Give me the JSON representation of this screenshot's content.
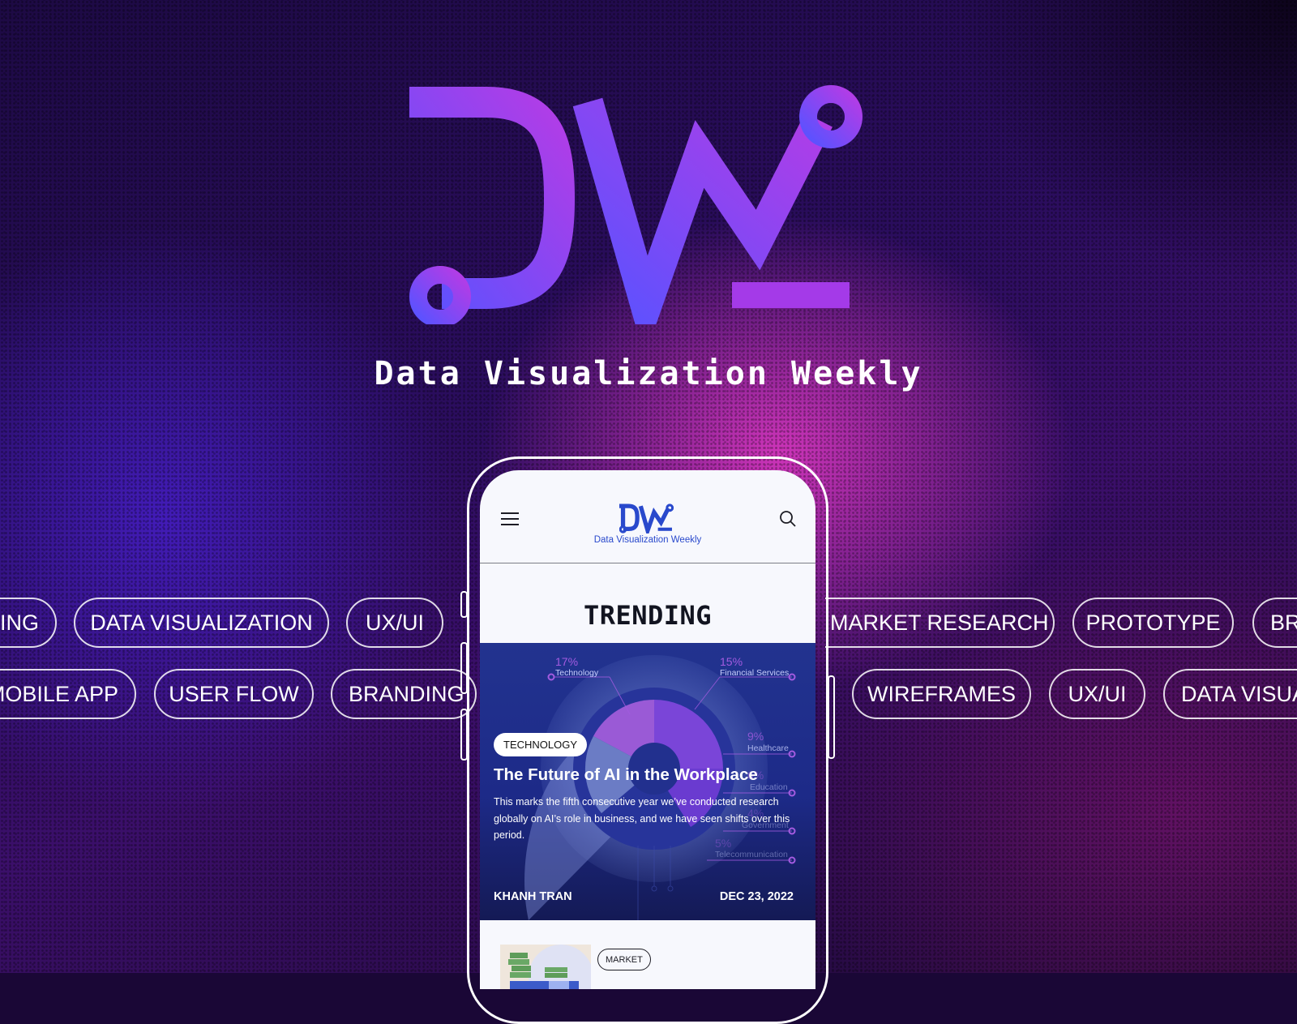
{
  "brand": {
    "logo_letters": "DW",
    "tagline": "Data Visualization Weekly",
    "colors": {
      "logo_gradient_start": "#5a52ff",
      "logo_gradient_end": "#b43ce6",
      "app_blue": "#2949cc",
      "hero_bg": "#1f2d8a",
      "chart_purple": "#a35be0"
    }
  },
  "tags": {
    "row1": [
      "BRANDING",
      "DATA VISUALIZATION",
      "UX/UI",
      "MARKET RESEARCH",
      "PROTOTYPE",
      "BRANDING"
    ],
    "row2": [
      "MOBILE APP",
      "USER FLOW",
      "BRANDING",
      "WIREFRAMES",
      "UX/UI",
      "DATA VISUALIZATION"
    ]
  },
  "phone": {
    "header": {
      "menu_icon": "hamburger-menu-icon",
      "search_icon": "search-icon",
      "logo_text": "Data Visualization Weekly"
    },
    "section_title": "TRENDING",
    "featured": {
      "category": "TECHNOLOGY",
      "title": "The Future of AI in the Workplace",
      "description": "This marks the fifth consecutive year we’ve conducted research globally on AI’s role in business, and we have seen shifts over this period.",
      "author": "KHANH TRAN",
      "date": "DEC 23, 2022",
      "infographic": [
        {
          "percent": "17%",
          "label": "Technology"
        },
        {
          "percent": "15%",
          "label": "Financial Services"
        },
        {
          "percent": "9%",
          "label": "Healthcare"
        },
        {
          "percent": "6%",
          "label": "Education"
        },
        {
          "percent": "4%",
          "label": "Government"
        },
        {
          "percent": "5%",
          "label": "Telecommunication"
        }
      ]
    },
    "next_card": {
      "category": "MARKET"
    }
  }
}
